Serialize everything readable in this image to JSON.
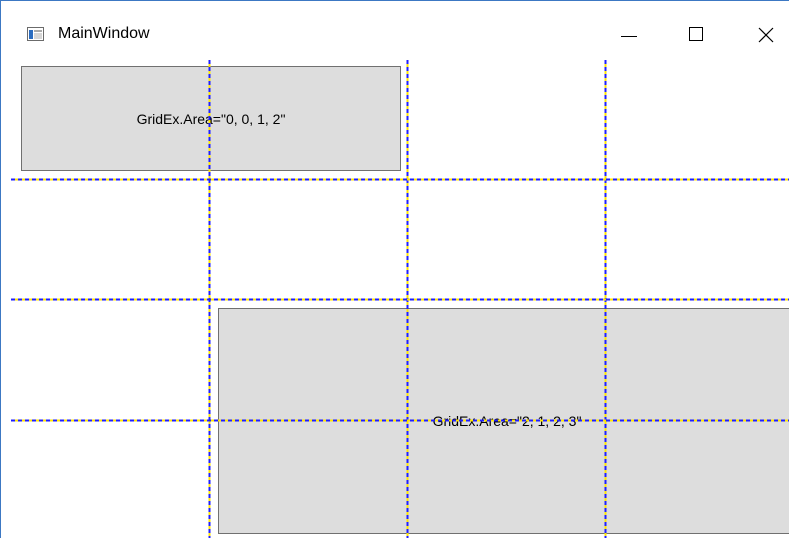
{
  "window": {
    "title": "MainWindow",
    "controls": {
      "minimize": "minimize",
      "maximize": "maximize",
      "close": "close"
    }
  },
  "grid": {
    "rows": 4,
    "columns": 4,
    "line_color": "#1f1fff",
    "line_color_alt": "#ffe600"
  },
  "buttons": [
    {
      "label": "GridEx.Area=\"0, 0, 1, 2\"",
      "color": "#dddddd"
    },
    {
      "label": "GridEx.Area=\"2, 1, 2, 3\"",
      "color": "#dddddd"
    }
  ]
}
